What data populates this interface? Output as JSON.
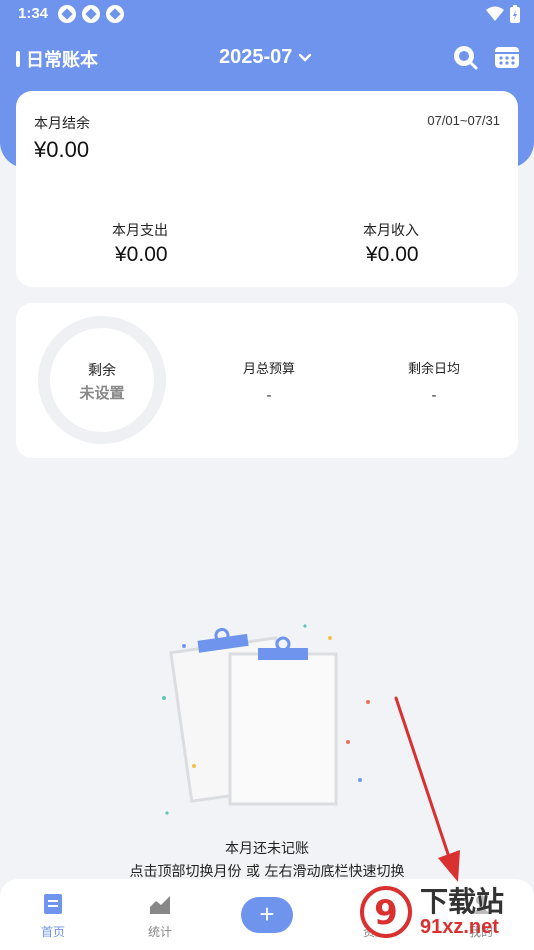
{
  "status_bar": {
    "time": "1:34"
  },
  "topbar": {
    "book_name": "日常账本",
    "month": "2025-07"
  },
  "summary": {
    "balance_label": "本月结余",
    "balance_value": "¥0.00",
    "date_range": "07/01~07/31",
    "expense_label": "本月支出",
    "expense_value": "¥0.00",
    "income_label": "本月收入",
    "income_value": "¥0.00"
  },
  "budget": {
    "ring_title": "剩余",
    "ring_value": "未设置",
    "monthly_budget_label": "月总预算",
    "monthly_budget_value": "-",
    "daily_avg_label": "剩余日均",
    "daily_avg_value": "-"
  },
  "empty_state": {
    "title": "本月还未记账",
    "hint": "点击顶部切换月份 或 左右滑动底栏快速切换"
  },
  "tabs": [
    {
      "label": "首页",
      "icon": "home-icon",
      "active": true
    },
    {
      "label": "统计",
      "icon": "chart-icon",
      "active": false
    },
    {
      "label": "+",
      "icon": "add-icon",
      "active": false
    },
    {
      "label": "资产",
      "icon": "asset-icon",
      "active": false
    },
    {
      "label": "我的",
      "icon": "profile-icon",
      "active": false
    }
  ],
  "watermark": {
    "text": "下载站",
    "url": "91xz.net",
    "logo": "9"
  },
  "colors": {
    "accent": "#6e94ee",
    "background": "#f2f3f7",
    "arrow": "#d93030"
  }
}
